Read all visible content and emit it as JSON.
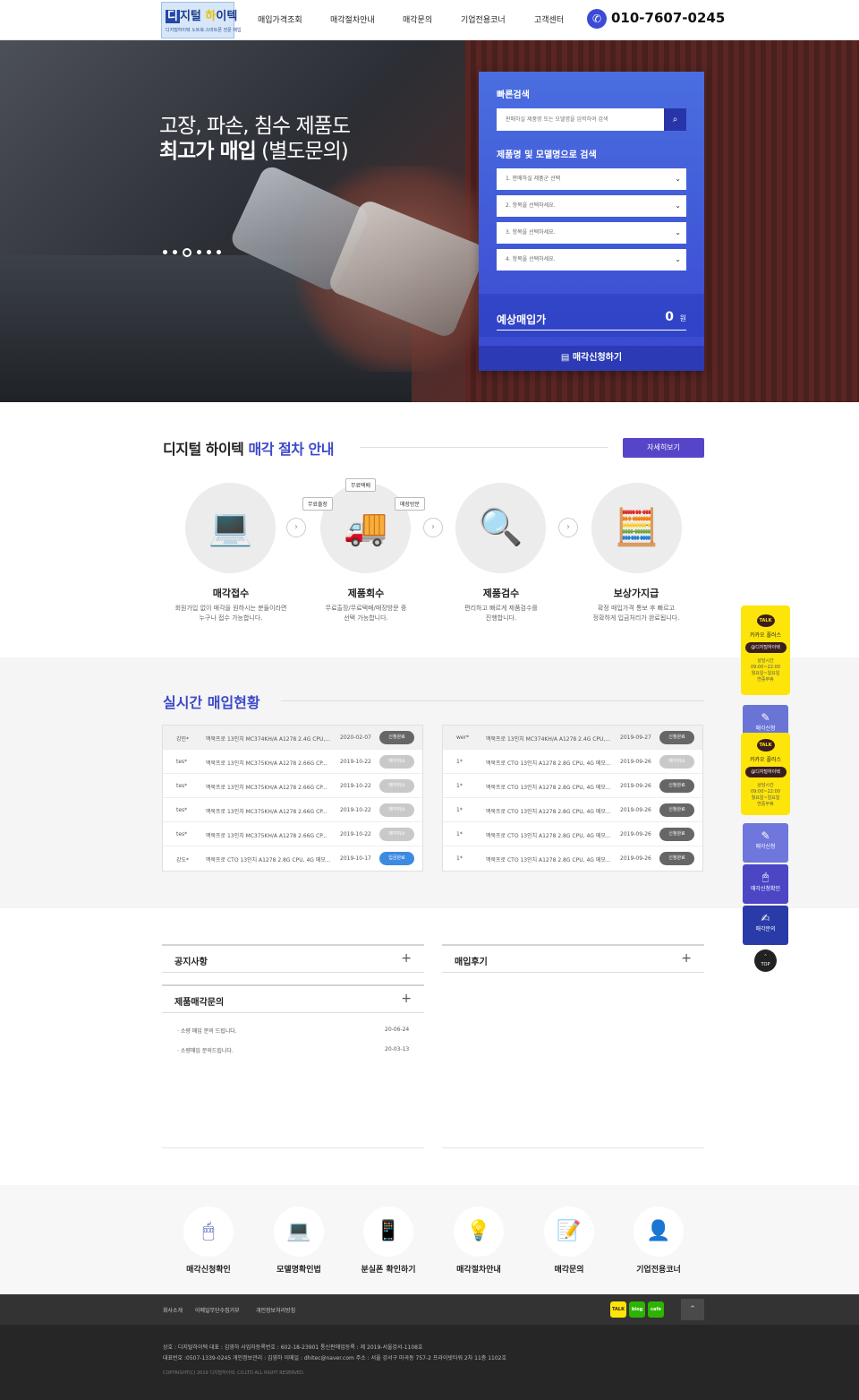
{
  "header": {
    "logo_main": "디지털 하이텍",
    "logo_first": "디",
    "logo_mid": "지털 ",
    "logo_ha": "하",
    "logo_end": "이텍",
    "logo_sub": "디지털하이텍 노트북·스마트폰 전문 매입",
    "nav": [
      "매입가격조회",
      "매각절차안내",
      "매각문의",
      "기업전용코너",
      "고객센터"
    ],
    "phone": "010-7607-0245"
  },
  "hero": {
    "line1": "고장, 파손, 침수 제품도",
    "line2_bold": "최고가 매입",
    "line2_rest": " (별도문의)",
    "slide_count": 6,
    "active_slide": 3
  },
  "quick_search": {
    "title": "빠른검색",
    "placeholder": "판매하실 제품명 또는 모델명을 입력하여 검색",
    "subtitle": "제품명 및 모델명으로 검색",
    "selects": [
      "1. 판매하실 제품군 선택",
      "2. 항목을 선택하세요.",
      "3. 항목을 선택하세요.",
      "4. 항목을 선택하세요."
    ],
    "price_label": "예상매입가",
    "price_value": "0",
    "price_unit": "원",
    "apply_label": "매각신청하기"
  },
  "process": {
    "title_plain": "디지털 하이텍 ",
    "title_accent": "매각 절차 안내",
    "more_label": "자세히보기",
    "bubbles": [
      "무료택배",
      "무료출장",
      "매장방문"
    ],
    "steps": [
      {
        "name": "매각접수",
        "desc1": "회원가입 없이 매각을 원하시는 분들이라면",
        "desc2": "누구나 접수 가능합니다."
      },
      {
        "name": "제품회수",
        "desc1": "무료출장/무료택배/매장방문 중",
        "desc2": "선택 가능합니다."
      },
      {
        "name": "제품검수",
        "desc1": "편리하고 빠르게 제품검수를",
        "desc2": "진행합니다."
      },
      {
        "name": "보상가지급",
        "desc1": "확정 매입가격 통보 후 빠르고",
        "desc2": "정확하게 입금처리가 완료됩니다."
      }
    ]
  },
  "realtime": {
    "title_plain": "실시간 ",
    "title_accent": "매입현황",
    "left": [
      {
        "name": "강민*",
        "product": "맥북프로 13인치 MC374KH/A A1278 2.4G CPU,...",
        "date": "2020-02-07",
        "status": "신청완료"
      },
      {
        "name": "tes*",
        "product": "맥북프로 13인치 MC375KH/A A1278 2.66G CP...",
        "date": "2019-10-22",
        "status": "매각취소"
      },
      {
        "name": "tes*",
        "product": "맥북프로 13인치 MC375KH/A A1278 2.66G CP...",
        "date": "2019-10-22",
        "status": "매각취소"
      },
      {
        "name": "tes*",
        "product": "맥북프로 13인치 MC375KH/A A1278 2.66G CP...",
        "date": "2019-10-22",
        "status": "매각취소"
      },
      {
        "name": "tes*",
        "product": "맥북프로 13인치 MC375KH/A A1278 2.66G CP...",
        "date": "2019-10-22",
        "status": "매각취소"
      },
      {
        "name": "강도*",
        "product": "맥북프로 CTO 13인치 A1278 2.8G CPU, 4G 메모...",
        "date": "2019-10-17",
        "status": "입금완료"
      }
    ],
    "right": [
      {
        "name": "wer*",
        "product": "맥북프로 13인치 MC374KH/A A1278 2.4G CPU,...",
        "date": "2019-09-27",
        "status": "신청완료"
      },
      {
        "name": "1*",
        "product": "맥북프로 CTO 13인치 A1278 2.8G CPU, 4G 메모...",
        "date": "2019-09-26",
        "status": "매각취소"
      },
      {
        "name": "1*",
        "product": "맥북프로 CTO 13인치 A1278 2.8G CPU, 4G 메모...",
        "date": "2019-09-26",
        "status": "신청완료"
      },
      {
        "name": "1*",
        "product": "맥북프로 CTO 13인치 A1278 2.8G CPU, 4G 메모...",
        "date": "2019-09-26",
        "status": "신청완료"
      },
      {
        "name": "1*",
        "product": "맥북프로 CTO 13인치 A1278 2.8G CPU, 4G 메모...",
        "date": "2019-09-26",
        "status": "신청완료"
      },
      {
        "name": "1*",
        "product": "맥북프로 CTO 13인치 A1278 2.8G CPU, 4G 메모...",
        "date": "2019-09-26",
        "status": "신청완료"
      }
    ]
  },
  "boards": {
    "notice": "공지사항",
    "review": "매입후기",
    "inquiry": "제품매각문의",
    "plus": "+",
    "inquiry_items": [
      {
        "title": "소량 매입 문의 드립니다.",
        "date": "20-06-24"
      },
      {
        "title": "소량매입 문의드립니다.",
        "date": "20-03-13"
      }
    ]
  },
  "quick_links": [
    "매각신청확인",
    "모델명확인법",
    "분실폰 확인하기",
    "매각절차안내",
    "매각문의",
    "기업전용코너"
  ],
  "footer": {
    "links": [
      "회사소개",
      "이메일무단수집거부",
      "개인정보처리방침"
    ],
    "sns": [
      "TALK",
      "blog",
      "cafe"
    ],
    "line1": "상호 : 디지털하이텍     대표 : 김영하     사업자등록번호 : 602-18-23901     통신판매업등록 : 제 2019-서울강서-1108호",
    "line2": "대표번호 :0507-1339-0245     개인정보관리 : 김영하     이메일 : dhitec@naver.com     주소 : 서울 강서구 마곡동 757-2 프라이빗타워 2차 11층 1102호",
    "copyright": "COPYRIGHT(C) 2019 디지털하이텍. CO.LTD ALL RIGHT RESERVED."
  },
  "floating": {
    "kakao_talk": "TALK",
    "kakao_plus": "카카오 플러스",
    "kakao_id": "@디지털하이텍",
    "kakao_hours1": "상담시간",
    "kakao_hours2": "09:00~22:00",
    "kakao_hours3": "월요일~일요일",
    "kakao_hours4": "연중무휴",
    "btn_apply": "매각신청",
    "btn_apply_peek": "매각신청",
    "btn_check": "매각신청확인",
    "btn_inquiry": "매각문의",
    "top": "TOP"
  },
  "colors": {
    "accent": "#3c49c9",
    "purple": "#5745c9",
    "kakao": "#fde50a"
  }
}
